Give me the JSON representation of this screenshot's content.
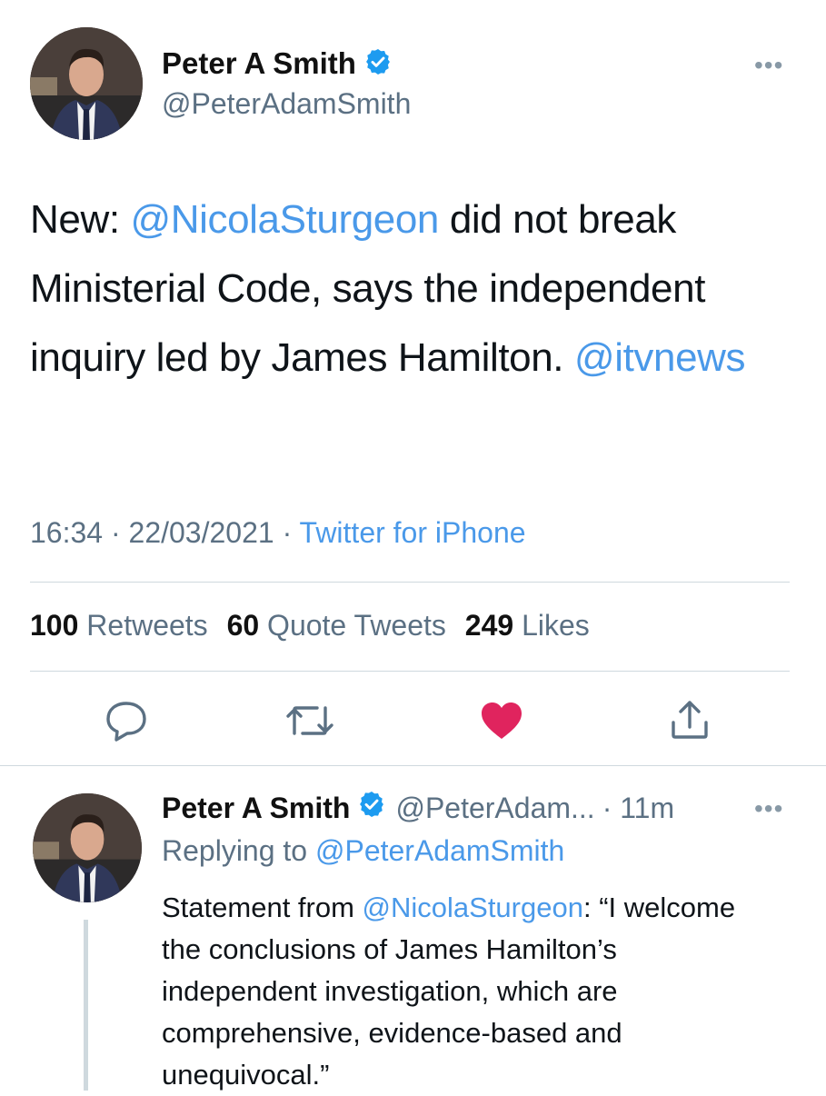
{
  "main_tweet": {
    "author_name": "Peter A Smith",
    "handle": "@PeterAdamSmith",
    "text_parts": {
      "p1": "New: ",
      "mention1": "@NicolaSturgeon",
      "p2": " did not break Ministerial Code, says the independent inquiry led by James Hamilton. ",
      "mention2": "@itvnews"
    },
    "time": "16:34",
    "date": "22/03/2021",
    "separator": "·",
    "source": "Twitter for iPhone",
    "stats": {
      "retweets_count": "100",
      "retweets_label": "Retweets",
      "quotes_count": "60",
      "quotes_label": "Quote Tweets",
      "likes_count": "249",
      "likes_label": "Likes"
    },
    "liked": true
  },
  "reply_tweet": {
    "author_name": "Peter A Smith",
    "handle_truncated": "@PeterAdam...",
    "time_ago": "· 11m",
    "replying_prefix": "Replying to ",
    "replying_to": "@PeterAdamSmith",
    "text_parts": {
      "p1": "Statement from ",
      "mention1": "@NicolaSturgeon",
      "p2": ": “I welcome the conclusions of James Hamilton’s independent investigation, which are comprehensive, evidence-based and unequivocal.”"
    }
  },
  "icons": [
    "verified-badge-icon",
    "more-icon",
    "reply-icon",
    "retweet-icon",
    "like-icon",
    "share-icon"
  ],
  "colors": {
    "link": "#4a99e9",
    "verified": "#1d9bf0",
    "like": "#e0245e",
    "secondary_text": "#5b7083"
  }
}
